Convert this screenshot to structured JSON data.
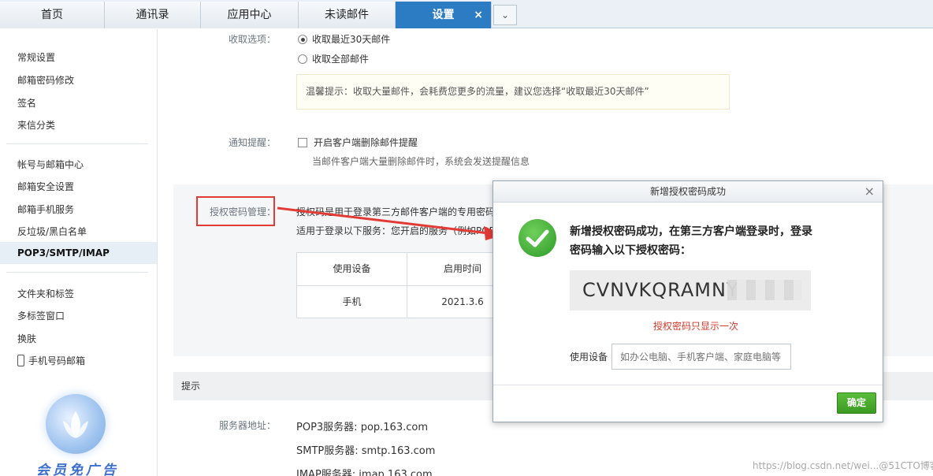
{
  "tabs": [
    {
      "label": "首页"
    },
    {
      "label": "通讯录"
    },
    {
      "label": "应用中心"
    },
    {
      "label": "未读邮件"
    },
    {
      "label": "设置",
      "close": "×"
    }
  ],
  "tab_more": "⌄",
  "sidebar": {
    "items": [
      {
        "label": "常规设置"
      },
      {
        "label": "邮箱密码修改"
      },
      {
        "label": "签名"
      },
      {
        "label": "来信分类"
      },
      {
        "label": "帐号与邮箱中心"
      },
      {
        "label": "邮箱安全设置"
      },
      {
        "label": "邮箱手机服务"
      },
      {
        "label": "反垃圾/黑白名单"
      },
      {
        "label": "POP3/SMTP/IMAP"
      },
      {
        "label": "文件夹和标签"
      },
      {
        "label": "多标签窗口"
      },
      {
        "label": "换肤"
      },
      {
        "label": "手机号码邮箱"
      }
    ],
    "promo_text": "会员免广告"
  },
  "main": {
    "receive_label": "收取选项：",
    "receive_opt1": "收取最近30天邮件",
    "receive_opt2": "收取全部邮件",
    "tip": "温馨提示：收取大量邮件，会耗费您更多的流量，建议您选择“收取最近30天邮件”",
    "notify_label": "通知提醒：",
    "notify_check": "开启客户端删除邮件提醒",
    "notify_desc": "当邮件客户端大量删除邮件时，系统会发送提醒信息",
    "auth_label": "授权密码管理：",
    "auth_desc1": "授权码是用于登录第三方邮件客户端的专用密码",
    "auth_desc2": "适用于登录以下服务：您开启的服务（例如POP",
    "table": {
      "headers": [
        "使用设备",
        "启用时间"
      ],
      "row": [
        "手机",
        "2021.3.6"
      ]
    },
    "section_title": "提示",
    "server_label": "服务器地址：",
    "pop3": "POP3服务器: pop.163.com",
    "smtp": "SMTP服务器: smtp.163.com",
    "imap": "IMAP服务器: imap.163.com"
  },
  "dialog": {
    "title": "新增授权密码成功",
    "close": "×",
    "message": "新增授权密码成功，在第三方客户端登录时，登录密码输入以下授权密码：",
    "code": "CVNVKQRAMNY",
    "once_note": "授权密码只显示一次",
    "device_label": "使用设备",
    "device_placeholder": "如办公电脑、手机客户端、家庭电脑等",
    "ok": "确定"
  },
  "watermark": "https://blog.csdn.net/wei...@51CTO博客",
  "colors": {
    "active_tab": "#2b7cc3",
    "highlight_box": "#e23b35",
    "success_green": "#3b9a22",
    "once_note": "#d23b2c"
  }
}
